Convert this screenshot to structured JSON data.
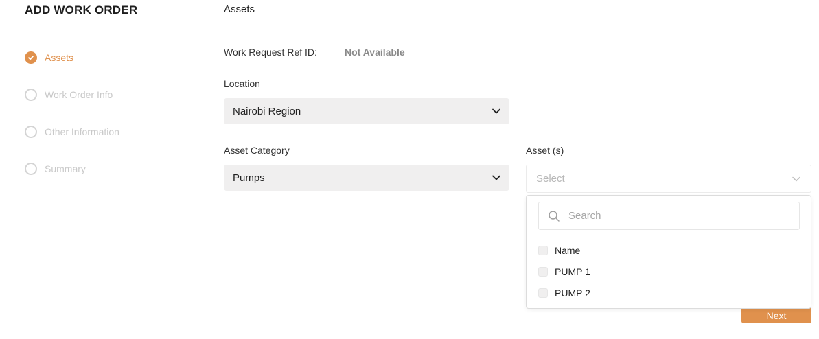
{
  "page_title": "ADD WORK ORDER",
  "colors": {
    "accent": "#e0914d",
    "inactive": "#c9c9c9",
    "field_bg": "#f0efef"
  },
  "steps": [
    {
      "label": "Assets",
      "state": "completed",
      "icon": "check-icon"
    },
    {
      "label": "Work Order Info",
      "state": "pending",
      "icon": "circle-icon"
    },
    {
      "label": "Other Information",
      "state": "pending",
      "icon": "circle-icon"
    },
    {
      "label": "Summary",
      "state": "pending",
      "icon": "circle-icon"
    }
  ],
  "section_title": "Assets",
  "work_request": {
    "label": "Work Request Ref ID:",
    "value": "Not Available"
  },
  "location": {
    "label": "Location",
    "value": "Nairobi Region"
  },
  "asset_category": {
    "label": "Asset Category",
    "value": "Pumps"
  },
  "assets": {
    "label": "Asset (s)",
    "placeholder": "Select",
    "dropdown_open": true,
    "search_placeholder": "Search",
    "options": [
      {
        "label": "Name",
        "checked": false
      },
      {
        "label": "PUMP 1",
        "checked": false
      },
      {
        "label": "PUMP 2",
        "checked": false
      }
    ]
  },
  "actions": {
    "next_label": "Next"
  }
}
